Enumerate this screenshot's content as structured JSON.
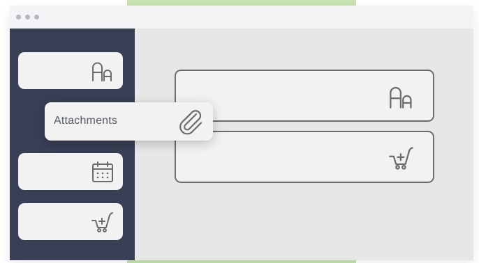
{
  "window": {
    "title_dots": [
      "dot-1",
      "dot-2",
      "dot-3"
    ]
  },
  "sidebar": {
    "items": [
      {
        "name": "text-field",
        "icon": "text-format-icon"
      },
      {
        "name": "date-field",
        "icon": "calendar-icon"
      },
      {
        "name": "add-to-cart-field",
        "icon": "cart-add-icon"
      }
    ]
  },
  "dragging_item": {
    "label": "Attachments",
    "icon": "paperclip-icon"
  },
  "canvas": {
    "fields": [
      {
        "name": "text-field",
        "icon": "text-format-icon"
      },
      {
        "name": "add-to-cart-field",
        "icon": "cart-add-icon"
      }
    ]
  },
  "colors": {
    "sidebar": "#393f54",
    "card": "#f2f2f2",
    "content_bg": "#e7e7e7",
    "accent_green": "#c6e3b0",
    "icon_stroke": "#6b6b6b"
  }
}
